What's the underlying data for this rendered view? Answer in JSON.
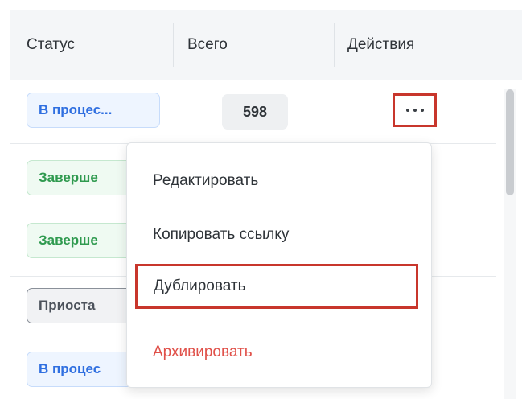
{
  "table": {
    "headers": [
      "Статус",
      "Всего",
      "Действия"
    ],
    "rows": [
      {
        "status": "В процес...",
        "status_type": "progress",
        "total": "598"
      },
      {
        "status": "Заверше",
        "status_type": "done"
      },
      {
        "status": "Заверше",
        "status_type": "done"
      },
      {
        "status": "Приоста",
        "status_type": "paused"
      },
      {
        "status": "В процес",
        "status_type": "progress"
      }
    ]
  },
  "menu": {
    "items": [
      "Редактировать",
      "Копировать ссылку",
      "Дублировать",
      "Архивировать"
    ]
  },
  "colors": {
    "highlight_outline": "#c8362c",
    "danger_text": "#e0514a",
    "progress_text": "#2f6fe0",
    "done_text": "#2f9a4f"
  }
}
